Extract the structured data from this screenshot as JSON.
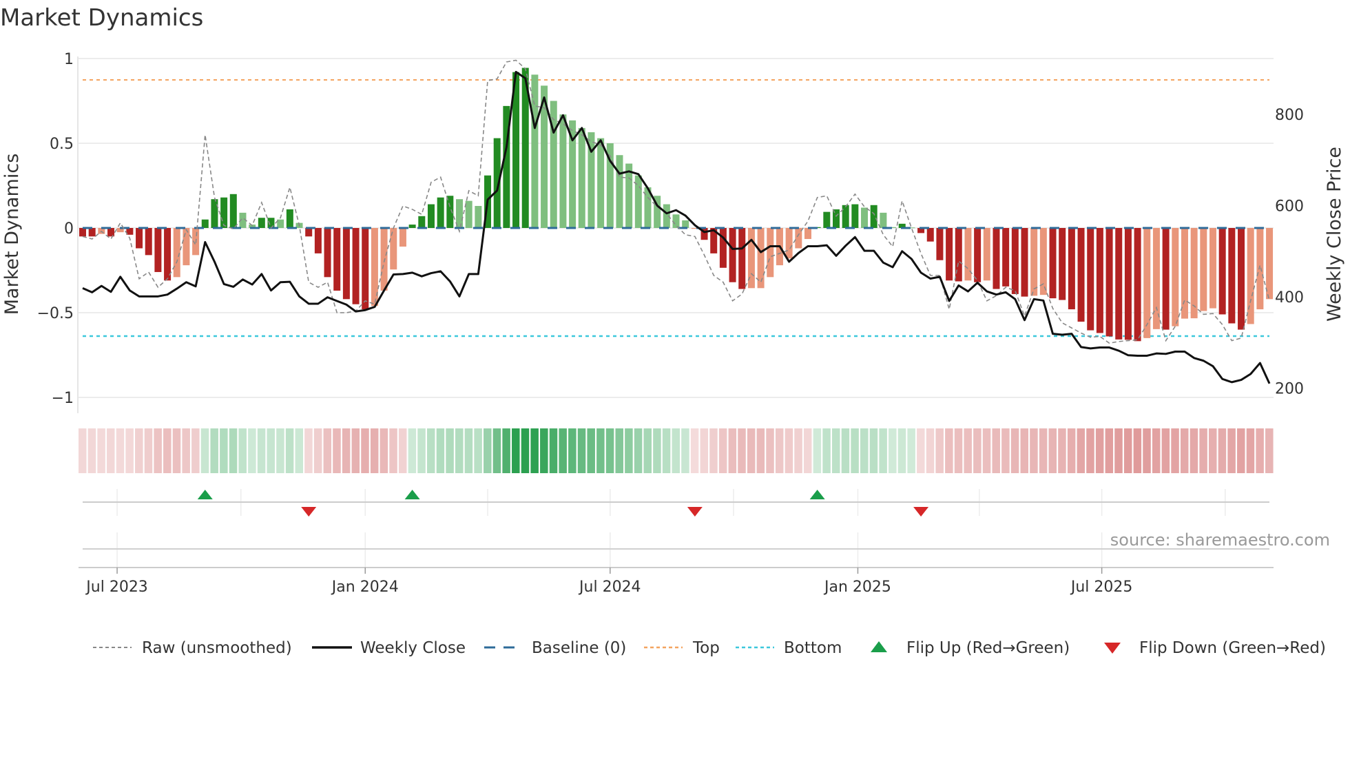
{
  "title": "Market Dynamics",
  "source": "source: sharemaestro.com",
  "colors": {
    "strong_green": "#228b22",
    "weak_green": "#7fbf7f",
    "strong_red": "#b22222",
    "weak_red": "#e9967a",
    "close": "#111111",
    "raw": "#888888",
    "baseline": "#2e6b99",
    "top": "#f4a460",
    "bottom": "#3cc8dc",
    "flip_up": "#1a9e4a",
    "flip_down": "#d62728"
  },
  "legend": [
    {
      "key": "raw",
      "label": "Raw (unsmoothed)"
    },
    {
      "key": "close",
      "label": "Weekly Close"
    },
    {
      "key": "baseline",
      "label": "Baseline (0)"
    },
    {
      "key": "top",
      "label": "Top"
    },
    {
      "key": "bottom",
      "label": "Bottom"
    },
    {
      "key": "flip_up",
      "label": "Flip Up (Red→Green)"
    },
    {
      "key": "flip_down",
      "label": "Flip Down (Green→Red)"
    }
  ],
  "chart_data": {
    "type": "bar",
    "title": "Market Dynamics",
    "ylabel": "Market Dynamics",
    "y2label": "Weekly Close Price",
    "ylim": [
      -1,
      1
    ],
    "y2lim": [
      200,
      900
    ],
    "yticks": [
      {
        "v": 1,
        "label": "1"
      },
      {
        "v": 0.5,
        "label": "0.5"
      },
      {
        "v": 0,
        "label": "0"
      },
      {
        "v": -0.5,
        "label": "−0.5"
      },
      {
        "v": -1,
        "label": "−1"
      }
    ],
    "y2ticks": [
      {
        "v": 800,
        "label": "800"
      },
      {
        "v": 600,
        "label": "600"
      },
      {
        "v": 400,
        "label": "400"
      },
      {
        "v": 200,
        "label": "200"
      }
    ],
    "xticks": [
      {
        "week": 3.66,
        "label": "Jul 2023"
      },
      {
        "week": 30.0,
        "label": "Jan 2024"
      },
      {
        "week": 56.0,
        "label": "Jul 2024"
      },
      {
        "week": 82.3,
        "label": "Jan 2025"
      },
      {
        "week": 108.2,
        "label": "Jul 2025"
      }
    ],
    "minor_xticks_week": [
      3.66,
      16.8,
      30.0,
      43.0,
      56.0,
      69.1,
      82.3,
      95.2,
      108.2,
      121.3
    ],
    "grid": true,
    "legend_position": "bottom",
    "top_threshold": 0.874,
    "bottom_threshold": -0.638,
    "baseline": 0,
    "smoothed": [
      -0.05,
      -0.05,
      -0.035,
      -0.05,
      -0.025,
      -0.04,
      -0.12,
      -0.16,
      -0.26,
      -0.31,
      -0.29,
      -0.22,
      -0.16,
      0.05,
      0.17,
      0.18,
      0.2,
      0.09,
      0.02,
      0.06,
      0.06,
      0.05,
      0.11,
      0.03,
      -0.05,
      -0.15,
      -0.29,
      -0.37,
      -0.42,
      -0.45,
      -0.48,
      -0.46,
      -0.37,
      -0.245,
      -0.11,
      0.02,
      0.07,
      0.14,
      0.18,
      0.19,
      0.17,
      0.16,
      0.13,
      0.31,
      0.53,
      0.72,
      0.92,
      0.945,
      0.905,
      0.84,
      0.75,
      0.67,
      0.635,
      0.59,
      0.565,
      0.53,
      0.5,
      0.43,
      0.38,
      0.31,
      0.24,
      0.19,
      0.14,
      0.08,
      0.045,
      -0.005,
      -0.07,
      -0.15,
      -0.235,
      -0.32,
      -0.36,
      -0.355,
      -0.355,
      -0.29,
      -0.22,
      -0.18,
      -0.12,
      -0.065,
      0.005,
      0.095,
      0.11,
      0.135,
      0.14,
      0.12,
      0.135,
      0.09,
      0.005,
      0.025,
      0.003,
      -0.03,
      -0.08,
      -0.19,
      -0.31,
      -0.315,
      -0.31,
      -0.32,
      -0.31,
      -0.36,
      -0.345,
      -0.39,
      -0.405,
      -0.4,
      -0.395,
      -0.415,
      -0.425,
      -0.48,
      -0.553,
      -0.604,
      -0.62,
      -0.64,
      -0.658,
      -0.66,
      -0.668,
      -0.65,
      -0.597,
      -0.6,
      -0.58,
      -0.535,
      -0.533,
      -0.49,
      -0.474,
      -0.51,
      -0.563,
      -0.6,
      -0.567,
      -0.48,
      -0.42
    ],
    "strong": [
      1,
      1,
      0,
      1,
      0,
      1,
      1,
      1,
      1,
      1,
      0,
      0,
      0,
      1,
      1,
      1,
      1,
      0,
      0,
      1,
      1,
      0,
      1,
      0,
      1,
      1,
      1,
      1,
      1,
      1,
      1,
      0,
      0,
      0,
      0,
      1,
      1,
      1,
      1,
      1,
      0,
      0,
      0,
      1,
      1,
      1,
      1,
      1,
      0,
      0,
      0,
      0,
      0,
      0,
      0,
      0,
      0,
      0,
      0,
      0,
      0,
      0,
      0,
      0,
      0,
      0,
      1,
      1,
      1,
      1,
      1,
      0,
      0,
      0,
      0,
      0,
      0,
      0,
      1,
      1,
      1,
      1,
      1,
      0,
      1,
      0,
      0,
      1,
      0,
      1,
      1,
      1,
      1,
      1,
      0,
      1,
      0,
      1,
      1,
      1,
      1,
      0,
      0,
      1,
      1,
      1,
      1,
      1,
      1,
      1,
      1,
      1,
      1,
      0,
      0,
      1,
      0,
      0,
      0,
      0,
      0,
      1,
      1,
      1,
      0,
      0,
      0
    ],
    "raw": [
      -0.05,
      -0.065,
      -0.02,
      -0.065,
      0.03,
      -0.06,
      -0.3,
      -0.26,
      -0.35,
      -0.3,
      -0.2,
      -0.01,
      -0.1,
      0.55,
      0.18,
      0.015,
      -0.005,
      0.06,
      0.015,
      0.15,
      0.0,
      0.06,
      0.24,
      0.015,
      -0.32,
      -0.35,
      -0.32,
      -0.5,
      -0.5,
      -0.49,
      -0.43,
      -0.45,
      -0.2,
      0.0,
      0.13,
      0.11,
      0.08,
      0.27,
      0.3,
      0.125,
      -0.02,
      0.22,
      0.19,
      0.87,
      0.88,
      0.98,
      0.99,
      0.94,
      0.72,
      0.71,
      0.64,
      0.615,
      0.575,
      0.55,
      0.51,
      0.49,
      0.425,
      0.3,
      0.295,
      0.25,
      0.18,
      0.125,
      0.085,
      0.015,
      -0.04,
      -0.05,
      -0.16,
      -0.28,
      -0.32,
      -0.43,
      -0.39,
      -0.27,
      -0.32,
      -0.17,
      -0.15,
      -0.13,
      -0.04,
      0.04,
      0.18,
      0.19,
      0.07,
      0.125,
      0.2,
      0.125,
      0.085,
      -0.04,
      -0.11,
      0.16,
      0.0,
      -0.15,
      -0.28,
      -0.28,
      -0.48,
      -0.195,
      -0.24,
      -0.31,
      -0.43,
      -0.4,
      -0.35,
      -0.37,
      -0.52,
      -0.36,
      -0.33,
      -0.475,
      -0.56,
      -0.59,
      -0.62,
      -0.645,
      -0.64,
      -0.68,
      -0.67,
      -0.665,
      -0.66,
      -0.57,
      -0.47,
      -0.665,
      -0.58,
      -0.425,
      -0.46,
      -0.51,
      -0.505,
      -0.57,
      -0.665,
      -0.65,
      -0.43,
      -0.22,
      -0.43
    ],
    "close": [
      419,
      410,
      424,
      411,
      444,
      414,
      401,
      401,
      401,
      405,
      418,
      432,
      423,
      520,
      477,
      428,
      422,
      438,
      427,
      450,
      414,
      432,
      433,
      401,
      385,
      385,
      399,
      391,
      383,
      368,
      371,
      378,
      414,
      449,
      450,
      453,
      445,
      452,
      456,
      434,
      401,
      450,
      450,
      613,
      633,
      728,
      893,
      879,
      770,
      837,
      760,
      798,
      743,
      770,
      718,
      743,
      698,
      670,
      675,
      669,
      638,
      600,
      583,
      590,
      578,
      557,
      542,
      546,
      530,
      505,
      506,
      525,
      498,
      511,
      511,
      477,
      496,
      511,
      511,
      513,
      490,
      512,
      531,
      501,
      501,
      475,
      465,
      500,
      483,
      453,
      440,
      444,
      391,
      425,
      412,
      431,
      412,
      405,
      410,
      395,
      349,
      395,
      392,
      319,
      317,
      319,
      290,
      287,
      289,
      289,
      282,
      272,
      271,
      271,
      276,
      275,
      280,
      280,
      266,
      260,
      248,
      220,
      213,
      218,
      231,
      255,
      210
    ],
    "flips_up_week": [
      13,
      35,
      78
    ],
    "flips_down_week": [
      24,
      65,
      89
    ]
  }
}
